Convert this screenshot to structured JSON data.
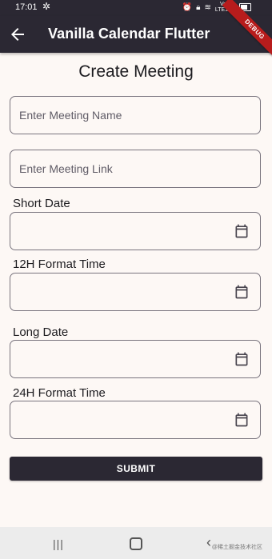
{
  "status_bar": {
    "time": "17:01",
    "network_line1": "VoB",
    "network_line2": "LTE1 ull"
  },
  "app_bar": {
    "title": "Vanilla Calendar Flutter",
    "debug_banner": "DEBUG"
  },
  "form": {
    "title": "Create Meeting",
    "meeting_name": {
      "placeholder": "Enter Meeting Name",
      "value": ""
    },
    "meeting_link": {
      "placeholder": "Enter Meeting Link",
      "value": ""
    },
    "short_date": {
      "label": "Short Date",
      "value": ""
    },
    "time_12h": {
      "label": "12H Format Time",
      "value": ""
    },
    "long_date": {
      "label": "Long Date",
      "value": ""
    },
    "time_24h": {
      "label": "24H Format Time",
      "value": ""
    },
    "submit_label": "SUBMIT"
  },
  "nav_bar": {
    "watermark": "@稀土掘金技术社区"
  },
  "colors": {
    "primary": "#2b2833",
    "background": "#fdf8f5",
    "outline": "#79747e"
  }
}
